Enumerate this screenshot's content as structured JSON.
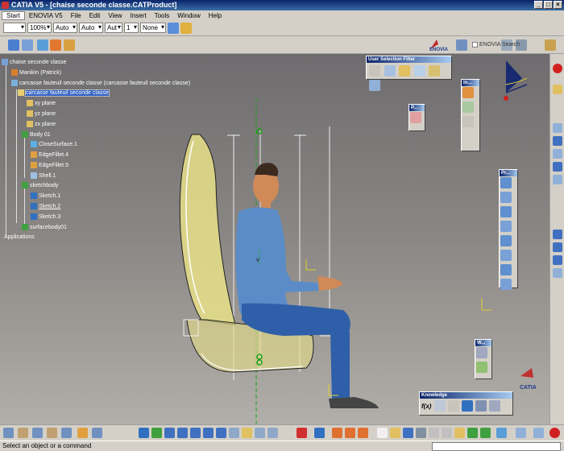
{
  "window": {
    "title": "CATIA V5 - [chaise seconde classe.CATProduct]",
    "buttons": [
      "_",
      "□",
      "×"
    ]
  },
  "menu": [
    "Start",
    "ENOVIA V5",
    "File",
    "Edit",
    "View",
    "Insert",
    "Tools",
    "Window",
    "Help"
  ],
  "toolbar": {
    "zoom": "100%",
    "combo_a": "Auto",
    "combo_b": "Auto",
    "combo_c": "Aut",
    "combo_d": "1",
    "combo_e": "None"
  },
  "enovia": {
    "brand": "ENOVIA",
    "search_label": "ENOVIA Search"
  },
  "tree": {
    "root": "chaise seconde classe",
    "manikin": "Manikin (Patrick)",
    "part": "carcasse fauteuil seconde classe (carcasse fauteuil seconde classe)",
    "part_selected": "carcasse fauteuil seconde classe",
    "planes": [
      "xy plane",
      "yz plane",
      "zx plane"
    ],
    "body": "Body 01",
    "features": [
      "CloseSurface.1",
      "EdgeFillet.4",
      "EdgeFillet.5",
      "Shell.1"
    ],
    "sketchbody": "sketchbody",
    "sketches": [
      "Sketch.1",
      "Sketch.2",
      "Sketch.3"
    ],
    "surfacebody": "surfacebody01",
    "applications": "Applications"
  },
  "panels": {
    "user_selection_filter": "User Selection Filter",
    "p_small": "P...",
    "in": "In...",
    "pr": "Pr...",
    "w": "W...",
    "knowledge": "Knowledge",
    "knowledge_fx": "f(x)"
  },
  "status": {
    "prompt": "Select an object or a command"
  },
  "colors": {
    "selection": "#3162c4",
    "manikin_skin": "#d08a58",
    "manikin_shirt": "#5b8cc8",
    "manikin_pants": "#2f5fa8",
    "seat_yellow": "#e8e088",
    "axis_green": "#1aa01a"
  },
  "compass": {
    "brand": "CATIA"
  }
}
